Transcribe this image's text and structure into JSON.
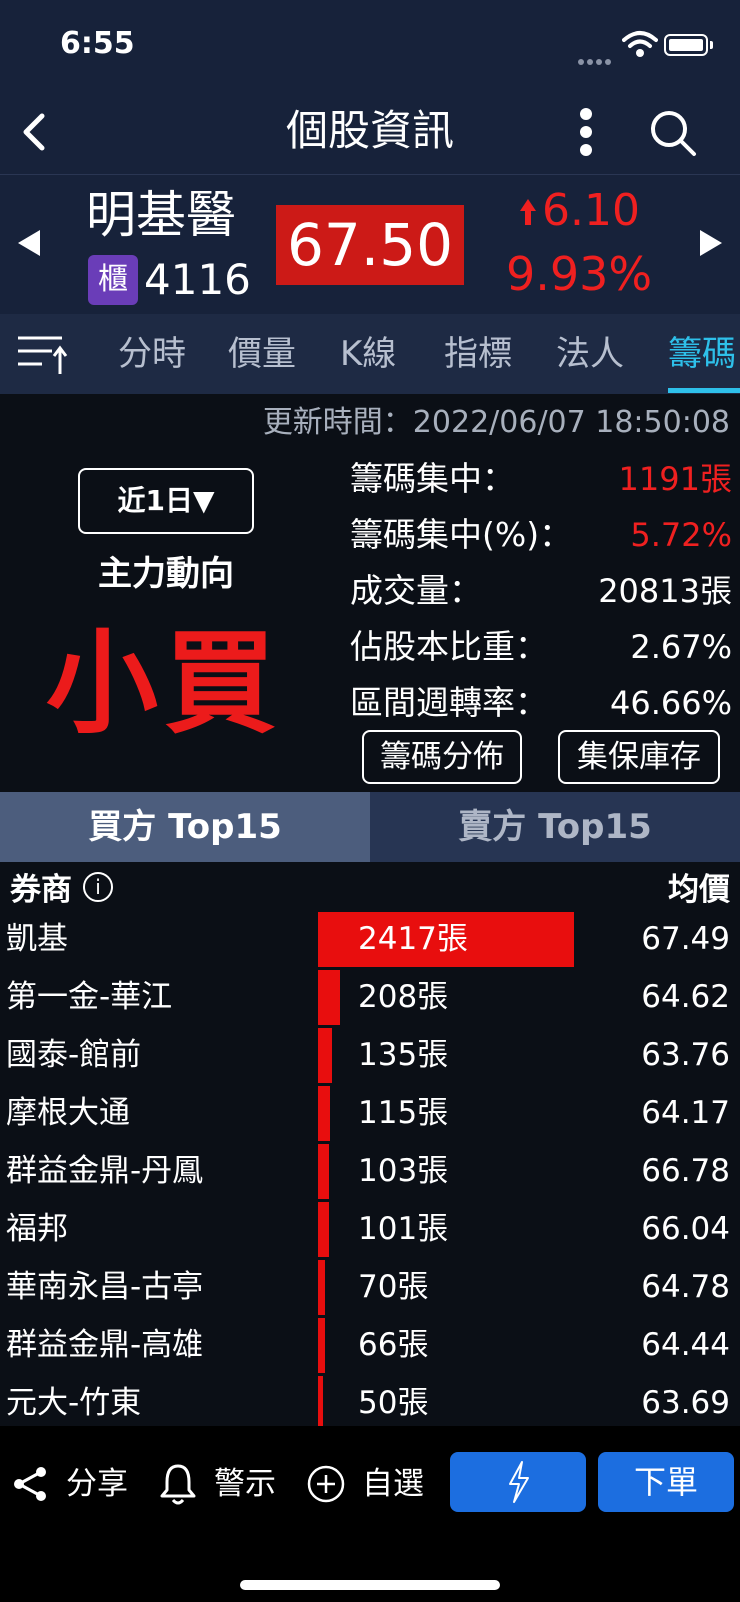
{
  "status_bar": {
    "time": "6:55"
  },
  "header": {
    "title": "個股資訊"
  },
  "stock": {
    "name": "明基醫",
    "market_badge": "櫃",
    "code": "4116",
    "price": "67.50",
    "change": "6.10",
    "change_pct": "9.93%"
  },
  "tabs": [
    {
      "label": "分時"
    },
    {
      "label": "價量"
    },
    {
      "label": "K線"
    },
    {
      "label": "指標"
    },
    {
      "label": "法人"
    },
    {
      "label": "籌碼",
      "active": true
    }
  ],
  "chips": {
    "update_time": "更新時間：2022/06/07 18:50:08",
    "period_select": "近1日▼",
    "flow_label": "主力動向",
    "flow_value": "小買",
    "stats": [
      {
        "label": "籌碼集中：",
        "value": "1191張",
        "color": "red"
      },
      {
        "label": "籌碼集中(%)：",
        "value": "5.72%",
        "color": "red"
      },
      {
        "label": "成交量：",
        "value": "20813張"
      },
      {
        "label": "佔股本比重：",
        "value": "2.67%"
      },
      {
        "label": "區間週轉率：",
        "value": "46.66%"
      }
    ],
    "buttons": {
      "distribution": "籌碼分佈",
      "custody": "集保庫存"
    }
  },
  "ranking": {
    "buy_tab": "買方 Top15",
    "sell_tab": "賣方 Top15",
    "col_broker": "券商",
    "col_avg": "均價",
    "max_volume": 2417,
    "rows": [
      {
        "broker": "凱基",
        "volume": 2417,
        "volume_label": "2417張",
        "avg": "67.49"
      },
      {
        "broker": "第一金-華江",
        "volume": 208,
        "volume_label": "208張",
        "avg": "64.62"
      },
      {
        "broker": "國泰-館前",
        "volume": 135,
        "volume_label": "135張",
        "avg": "63.76"
      },
      {
        "broker": "摩根大通",
        "volume": 115,
        "volume_label": "115張",
        "avg": "64.17"
      },
      {
        "broker": "群益金鼎-丹鳳",
        "volume": 103,
        "volume_label": "103張",
        "avg": "66.78"
      },
      {
        "broker": "福邦",
        "volume": 101,
        "volume_label": "101張",
        "avg": "66.04"
      },
      {
        "broker": "華南永昌-古亭",
        "volume": 70,
        "volume_label": "70張",
        "avg": "64.78"
      },
      {
        "broker": "群益金鼎-高雄",
        "volume": 66,
        "volume_label": "66張",
        "avg": "64.44"
      },
      {
        "broker": "元大-竹東",
        "volume": 50,
        "volume_label": "50張",
        "avg": "63.69"
      }
    ]
  },
  "bottom_bar": {
    "share": "分享",
    "alert": "警示",
    "watchlist": "自選",
    "order": "下單"
  },
  "colors": {
    "up_red": "#ef2020",
    "accent_blue": "#2ec0ea",
    "button_blue": "#1c6ee0",
    "bar_red": "#e80e0e"
  }
}
